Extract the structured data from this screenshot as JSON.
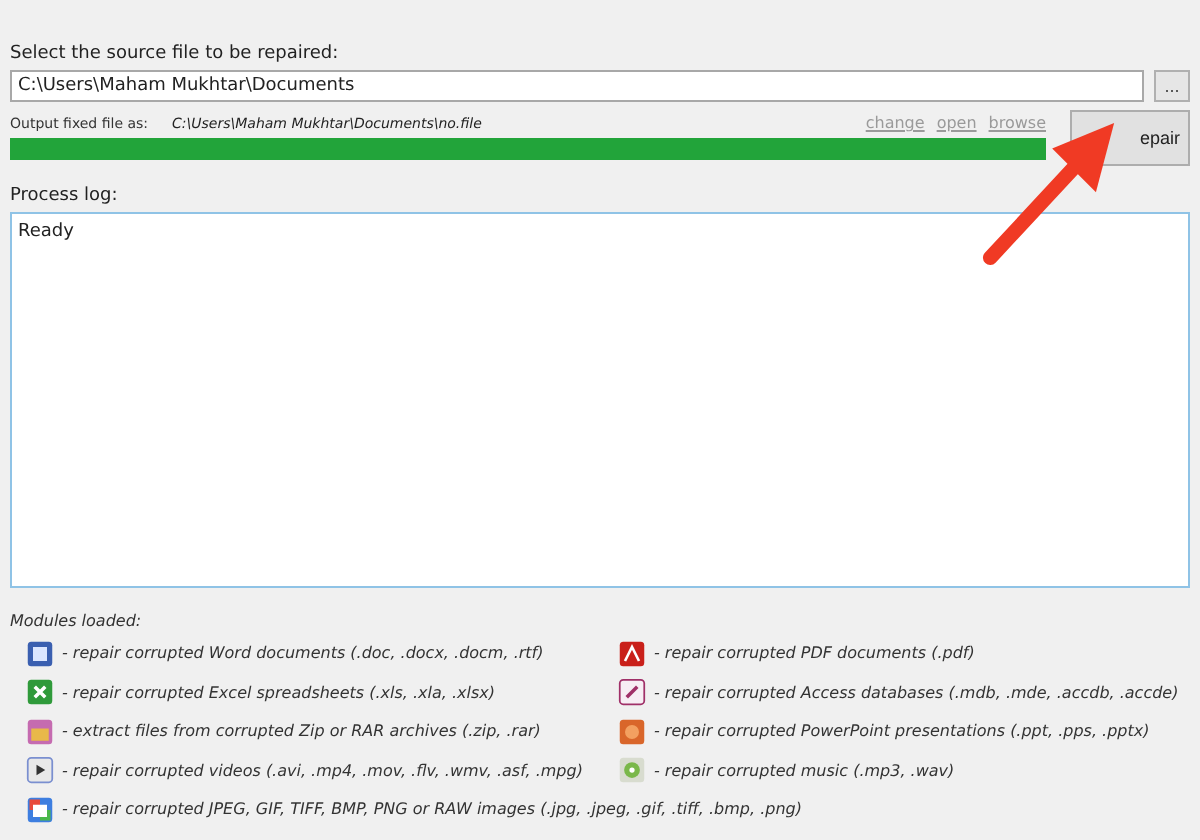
{
  "source": {
    "label": "Select the source file to be repaired:",
    "value": "C:\\Users\\Maham Mukhtar\\Documents",
    "browse_button": "..."
  },
  "output": {
    "label": "Output fixed file as:",
    "path": "C:\\Users\\Maham Mukhtar\\Documents\\no.file",
    "links": [
      "change",
      "open",
      "browse"
    ],
    "level": 1
  },
  "repair_button": "epair",
  "log": {
    "label": "Process log:",
    "text": "Ready"
  },
  "modules": {
    "label": "Modules loaded:",
    "items": [
      {
        "kind": "word",
        "text": "- repair corrupted Word documents (.doc, .docx, .docm, .rtf)"
      },
      {
        "kind": "excel",
        "text": "- repair corrupted Excel spreadsheets (.xls, .xla, .xlsx)"
      },
      {
        "kind": "archive",
        "text": "- extract files from corrupted Zip or RAR archives (.zip, .rar)"
      },
      {
        "kind": "video",
        "text": "- repair corrupted videos (.avi, .mp4, .mov, .flv, .wmv, .asf, .mpg)"
      },
      {
        "kind": "image",
        "text": "- repair corrupted JPEG, GIF, TIFF, BMP, PNG or RAW images (.jpg, .jpeg, .gif, .tiff, .bmp, .png)"
      },
      {
        "kind": "pdf",
        "text": "- repair corrupted PDF documents (.pdf)"
      },
      {
        "kind": "access",
        "text": "- repair corrupted Access databases (.mdb, .mde, .accdb, .accde)"
      },
      {
        "kind": "powerpoint",
        "text": "- repair corrupted PowerPoint presentations (.ppt, .pps, .pptx)"
      },
      {
        "kind": "music",
        "text": "- repair corrupted music (.mp3, .wav)"
      }
    ]
  }
}
